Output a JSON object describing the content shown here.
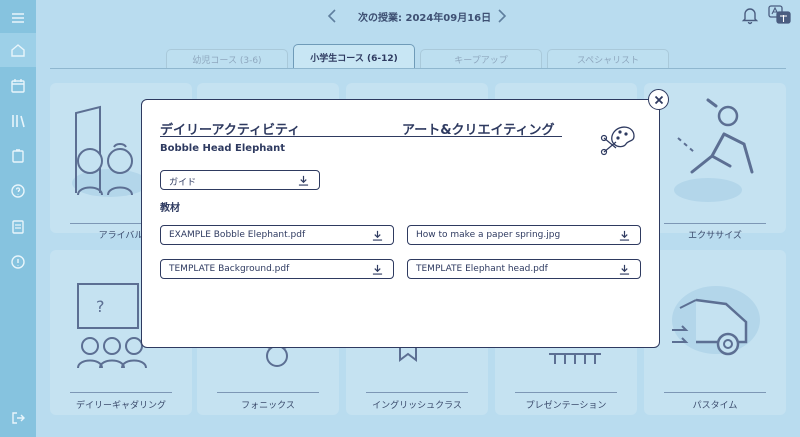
{
  "header": {
    "next_lesson": "次の授業: 2024年09月16日"
  },
  "tabs": [
    {
      "label": "幼児コース (3-6)",
      "active": false
    },
    {
      "label": "小学生コース (6-12)",
      "active": true
    },
    {
      "label": "キープアップ",
      "active": false
    },
    {
      "label": "スペシャリスト",
      "active": false
    }
  ],
  "cards": [
    {
      "label": "アライバル",
      "icon": "arrival-children-icon"
    },
    {
      "label": "エクササイズ",
      "icon": "exercise-icon"
    },
    {
      "label": "デイリーギャダリング",
      "icon": "daily-gathering-icon"
    },
    {
      "label": "フォニックス",
      "icon": "phonics-icon"
    },
    {
      "label": "イングリッシュクラス",
      "icon": "english-class-icon"
    },
    {
      "label": "プレゼンテーション",
      "icon": "presentation-icon"
    },
    {
      "label": "パスタイム",
      "icon": "pastime-car-icon"
    }
  ],
  "modal": {
    "title_left": "デイリーアクティビティ",
    "title_right": "アート&クリエイティング",
    "subtitle": "Bobble Head Elephant",
    "guide_label": "ガイド",
    "materials_label": "教材",
    "files": [
      "EXAMPLE Bobble Elephant.pdf",
      "How to make a paper spring.jpg",
      "TEMPLATE Background.pdf",
      "TEMPLATE Elephant head.pdf"
    ]
  },
  "colors": {
    "background": "#b9dcef",
    "sidebar": "#86c3df",
    "ink": "#2e3a60",
    "modal": "#ffffff"
  }
}
